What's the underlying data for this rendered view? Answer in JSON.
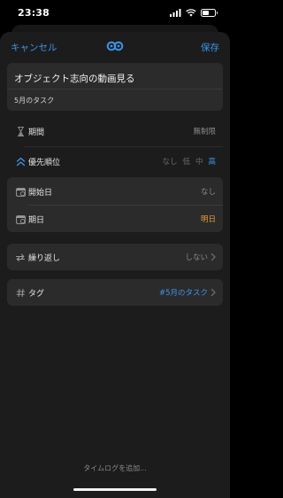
{
  "status_bar": {
    "time": "23:38",
    "battery_level": 0.55
  },
  "nav": {
    "cancel_label": "キャンセル",
    "save_label": "保存"
  },
  "task": {
    "title": "オブジェクト志向の動画見る",
    "subtitle": "5月のタスク"
  },
  "rows": {
    "period": {
      "label": "期間",
      "value": "無制限"
    },
    "priority": {
      "label": "優先順位",
      "options": [
        "なし",
        "低",
        "中",
        "高"
      ],
      "selected": "高"
    },
    "start_date": {
      "label": "開始日",
      "value": "なし"
    },
    "due_date": {
      "label": "期日",
      "value": "明日"
    },
    "repeat": {
      "label": "繰り返し",
      "value": "しない"
    },
    "tag": {
      "label": "タグ",
      "value": "#5月のタスク"
    }
  },
  "footer": {
    "add_timelog": "タイムログを追加..."
  },
  "colors": {
    "accent": "#3b95e8",
    "due_date": "#e89a3c",
    "card_background": "#2b2b2b",
    "sheet_background": "#1c1c1c"
  }
}
